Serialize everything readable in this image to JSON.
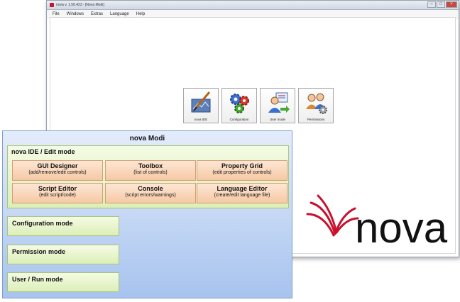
{
  "window": {
    "title": "nova v. 1.50.423 - [Nova Modi]",
    "controls": {
      "minimize": "–",
      "maximize": "□",
      "close": "×"
    }
  },
  "menu": [
    "File",
    "Windows",
    "Extras",
    "Language",
    "Help"
  ],
  "tiles": [
    {
      "label": "nova IDE",
      "icon": "ide-brush-icon"
    },
    {
      "label": "Configuration",
      "icon": "gears-icon"
    },
    {
      "label": "User mode",
      "icon": "user-mode-icon"
    },
    {
      "label": "Permissions",
      "icon": "permissions-icon"
    }
  ],
  "logo": {
    "text": "nova"
  },
  "modi": {
    "title": "nova Modi",
    "ide": {
      "title": "nova IDE / Edit mode",
      "tools": [
        {
          "title": "GUI Designer",
          "subtitle": "(add/remove/edit controls)"
        },
        {
          "title": "Toolbox",
          "subtitle": "(list of controls)"
        },
        {
          "title": "Property Grid",
          "subtitle": "(edit properties of controls)"
        },
        {
          "title": "Script Editor",
          "subtitle": "(edit script/code)"
        },
        {
          "title": "Console",
          "subtitle": "(script errors/warnings)"
        },
        {
          "title": "Language Editor",
          "subtitle": "(create/edit language file)"
        }
      ]
    },
    "modes": [
      "Configuration mode",
      "Permission mode",
      "User / Run mode"
    ]
  },
  "colors": {
    "accent": "#c8102e",
    "panel_blue": "#a7c3ee",
    "panel_green": "#dcefb8",
    "tool_orange": "#f6c9a5"
  }
}
